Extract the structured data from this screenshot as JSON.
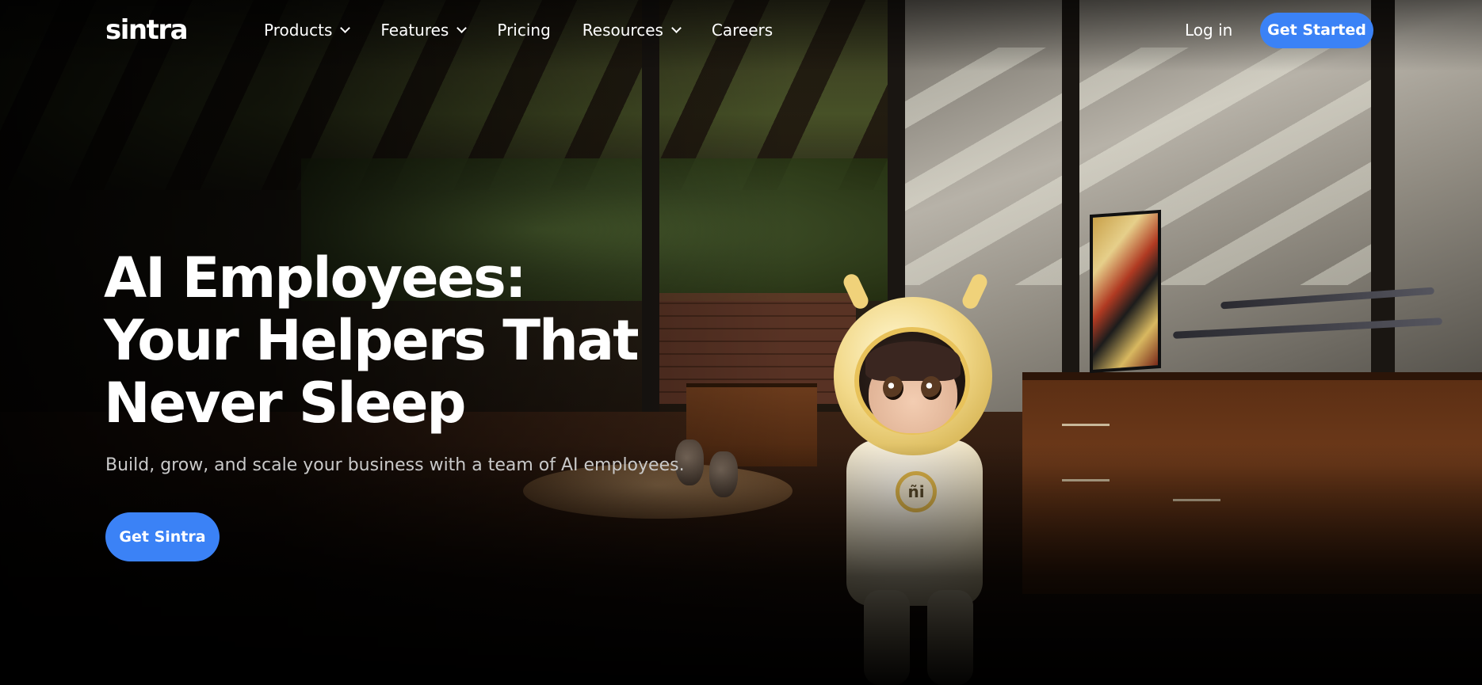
{
  "brand": {
    "logo_text": "sintra",
    "accent_color": "#3b82f6"
  },
  "nav": {
    "items": [
      {
        "label": "Products",
        "has_dropdown": true
      },
      {
        "label": "Features",
        "has_dropdown": true
      },
      {
        "label": "Pricing",
        "has_dropdown": false
      },
      {
        "label": "Resources",
        "has_dropdown": true
      },
      {
        "label": "Careers",
        "has_dropdown": false
      }
    ],
    "login_label": "Log in",
    "cta_label": "Get Started"
  },
  "hero": {
    "title": "AI Employees: Your Helpers That Never Sleep",
    "subtitle": "Build, grow, and scale your business with a team of AI employees.",
    "cta_label": "Get Sintra",
    "mascot_badge": "ñi"
  }
}
